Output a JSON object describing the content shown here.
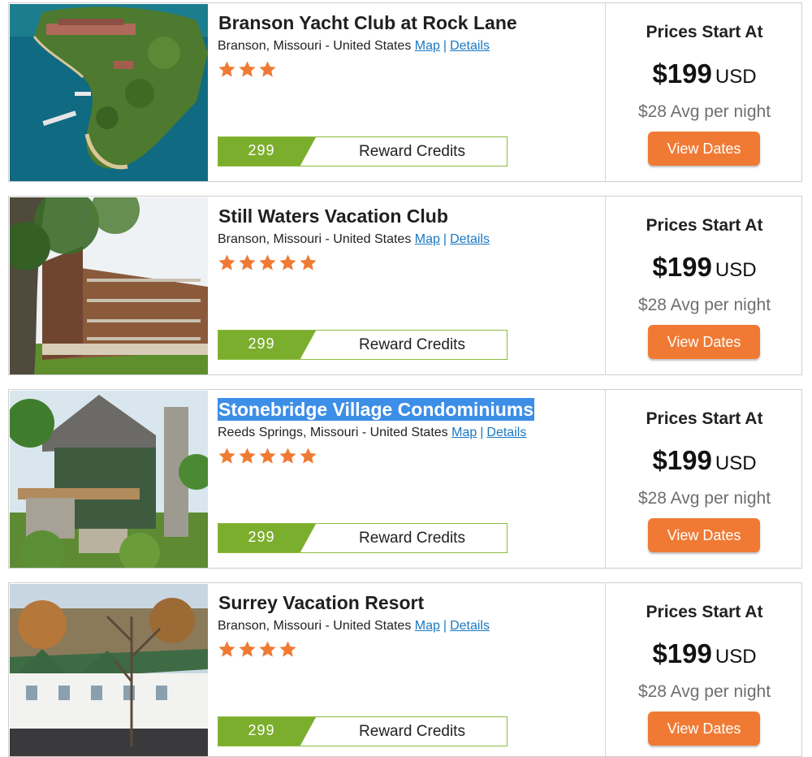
{
  "common": {
    "reward_points": "299",
    "reward_label": "Reward Credits",
    "price_header": "Prices Start At",
    "price_amount": "$199",
    "price_currency": "USD",
    "avg_per_night": "$28 Avg per night",
    "view_dates": "View Dates",
    "map_label": "Map",
    "details_label": "Details",
    "separator": "|",
    "star_color": "#f07a34",
    "button_color": "#f07a34",
    "reward_color": "#7cae2d",
    "link_color": "#1a78c2"
  },
  "resorts": [
    {
      "name": "Branson Yacht Club at Rock Lane",
      "location": "Branson, Missouri - United States",
      "rating": 3,
      "image": "aerial lake peninsula resort"
    },
    {
      "name": "Still Waters Vacation Club",
      "location": "Branson, Missouri - United States",
      "rating": 5,
      "image": "brown condo building with tree"
    },
    {
      "name": "Stonebridge Village Condominiums",
      "location": "Reeds Springs, Missouri - United States",
      "rating": 5,
      "selected": true,
      "image": "stone lodge with deck"
    },
    {
      "name": "Surrey Vacation Resort",
      "location": "Branson, Missouri - United States",
      "rating": 4,
      "image": "white townhomes green roofs"
    }
  ]
}
